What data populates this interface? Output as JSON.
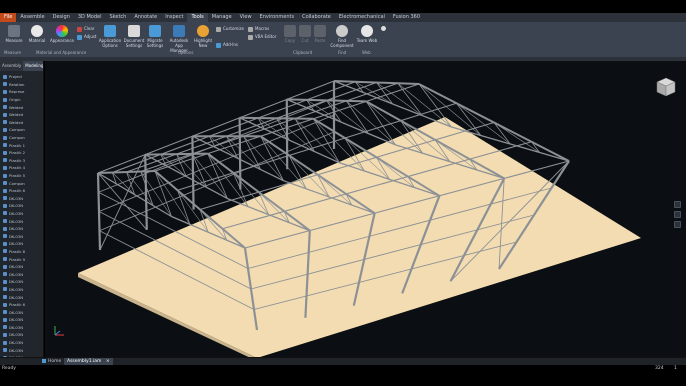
{
  "menubar": {
    "tabs": [
      "File",
      "Assemble",
      "Design",
      "3D Model",
      "Sketch",
      "Annotate",
      "Inspect",
      "Tools",
      "Manage",
      "View",
      "Environments",
      "Collaborate",
      "Electromechanical",
      "Fusion 360"
    ],
    "active_tab": "Tools"
  },
  "ribbon": {
    "measure": "Measure",
    "material": "Material",
    "appearance": "Appearance",
    "clear": "Clear",
    "adjust": "Adjust",
    "application_options": "Application Options",
    "document_settings": "Document Settings",
    "migrate_settings": "Migrate Settings",
    "autodesk_app_manager": "Autodesk App Manager",
    "highlight_new": "Highlight New",
    "customize": "Customize",
    "macros": "Macros",
    "vba_editor": "VBA Editor",
    "add_ins": "Add-Ins",
    "copy": "Copy",
    "cut": "Cut",
    "paste": "Paste",
    "find_component": "Find Component",
    "team_web": "Team Web",
    "panels": {
      "measure": "Measure",
      "material_appearance": "Material and Appearance",
      "options": "Options",
      "clipboard": "Clipboard",
      "find": "Find",
      "web": "Web"
    }
  },
  "browser": {
    "tabs": [
      "Assembly",
      "Modeling"
    ],
    "items": [
      "Project",
      "Relation",
      "Represe",
      "Origin",
      "Welded",
      "Welded",
      "Welded",
      "Compon",
      "Compon",
      "Plastik 1",
      "Plastik 2",
      "Plastik 3",
      "Plastik 4",
      "Plastik 5",
      "Compon",
      "Plastik 6",
      "DK-03N",
      "DK-03N",
      "DK-03N",
      "DK-03N",
      "DK-03N",
      "DK-03N",
      "DK-03N",
      "Plastik 8",
      "Plastik 9",
      "DK-03N",
      "DK-03N",
      "DK-03N",
      "DK-03N",
      "DK-03N",
      "Plastik 6",
      "DK-03N",
      "DK-03N",
      "DK-03N",
      "DK-03N",
      "DK-03N",
      "DK-03N",
      "DK-03N",
      "Plastik 9"
    ]
  },
  "document_tabs": {
    "home": "Home",
    "active": "Assembly1.iam"
  },
  "status": {
    "left": "Ready",
    "count1": "324",
    "count2": "1"
  },
  "colors": {
    "accent_file": "#c24a1b",
    "ribbon_bg": "#3b4350",
    "viewport_bg": "#0b0e12",
    "floor": "#f3dcb1",
    "steel": "#8c9196"
  }
}
